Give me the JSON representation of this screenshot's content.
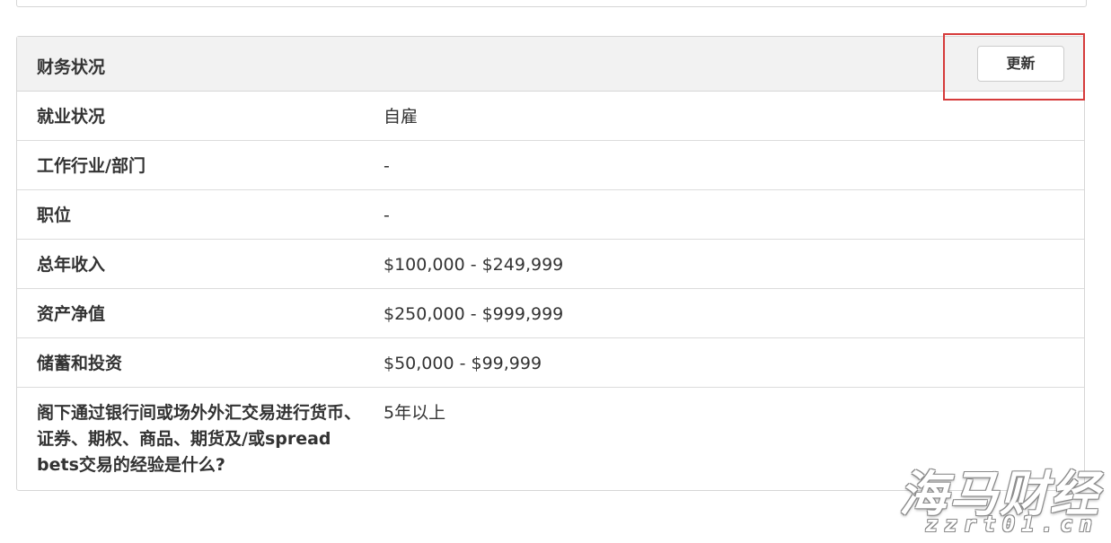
{
  "panel": {
    "title": "财务状况",
    "update_label": "更新"
  },
  "rows": [
    {
      "label": "就业状况",
      "value": "自雇"
    },
    {
      "label": "工作行业/部门",
      "value": "-"
    },
    {
      "label": "职位",
      "value": "-"
    },
    {
      "label": "总年收入",
      "value": "$100,000 - $249,999"
    },
    {
      "label": "资产净值",
      "value": "$250,000 - $999,999"
    },
    {
      "label": "储蓄和投资",
      "value": "$50,000 - $99,999"
    },
    {
      "label": "阁下通过银行间或场外外汇交易进行货币、证券、期权、商品、期货及/或spread bets交易的经验是什么?",
      "value": "5年以上"
    }
  ],
  "watermark": {
    "title": "海马财经",
    "url": "zzrt01.cn"
  },
  "colors": {
    "highlight": "#d63b3b",
    "header_bg": "#f2f2f2",
    "border": "#d6d6d6"
  }
}
